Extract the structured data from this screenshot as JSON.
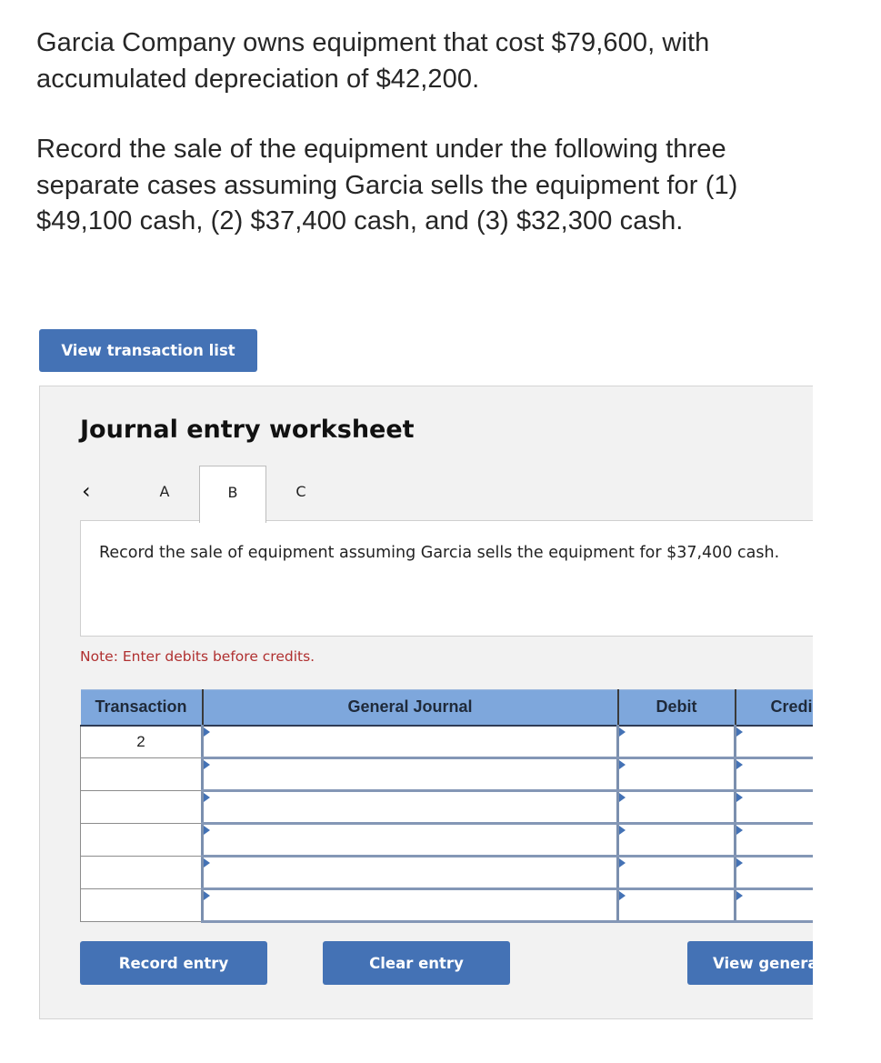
{
  "problem": {
    "paragraph_1": "Garcia Company owns equipment that cost $79,600, with accumulated depreciation of $42,200.",
    "paragraph_2": "Record the sale of the equipment under the following three separate cases assuming Garcia sells the equipment for (1) $49,100 cash, (2) $37,400 cash, and (3) $32,300 cash."
  },
  "buttons": {
    "view_transaction_list": "View transaction list",
    "record_entry": "Record entry",
    "clear_entry": "Clear entry",
    "view_general_journal": "View genera"
  },
  "worksheet": {
    "title": "Journal entry worksheet",
    "prev_icon": "chevron-left-icon",
    "tabs": [
      {
        "label": "A",
        "active": false
      },
      {
        "label": "B",
        "active": true
      },
      {
        "label": "C",
        "active": false
      }
    ],
    "prompt": "Record the sale of equipment assuming Garcia sells the equipment for $37,400 cash.",
    "note": "Note: Enter debits before credits."
  },
  "journal": {
    "columns": [
      "Transaction",
      "General Journal",
      "Debit",
      "Credi"
    ],
    "rows": [
      {
        "transaction": "2",
        "account": "",
        "debit": "",
        "credit": ""
      },
      {
        "transaction": "",
        "account": "",
        "debit": "",
        "credit": ""
      },
      {
        "transaction": "",
        "account": "",
        "debit": "",
        "credit": ""
      },
      {
        "transaction": "",
        "account": "",
        "debit": "",
        "credit": ""
      },
      {
        "transaction": "",
        "account": "",
        "debit": "",
        "credit": ""
      },
      {
        "transaction": "",
        "account": "",
        "debit": "",
        "credit": ""
      }
    ]
  },
  "colors": {
    "button_blue": "#4472b5",
    "header_blue": "#7ea7dc",
    "note_red": "#b03030",
    "panel_gray": "#f2f2f2"
  }
}
